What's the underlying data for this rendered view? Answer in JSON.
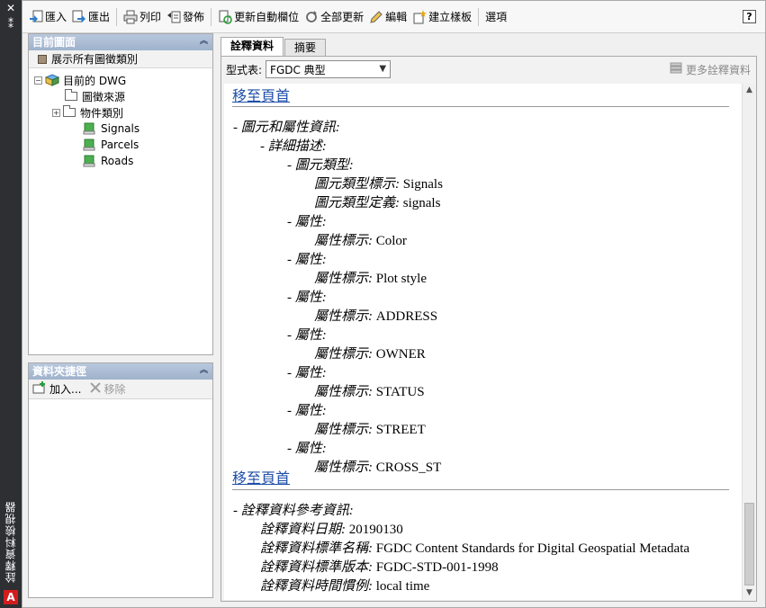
{
  "sidebar_strip": {
    "close_glyph": "✕",
    "menu_glyph": "⁑",
    "title": "詮釋資料檢視器",
    "logo_letter": "A"
  },
  "toolbar": {
    "import_label": "匯入",
    "export_label": "匯出",
    "print_label": "列印",
    "publish_label": "發佈",
    "update_auto_fields_label": "更新自動欄位",
    "update_all_label": "全部更新",
    "edit_label": "編輯",
    "create_template_label": "建立樣板",
    "options_label": "選項",
    "help_label": "?"
  },
  "current_drawing_panel": {
    "title": "目前圖面",
    "show_all_label": "展示所有圖徵類別",
    "tree": {
      "root": "目前的 DWG",
      "feature_source": "圖徵來源",
      "object_classes": "物件類別",
      "layers": [
        "Signals",
        "Parcels",
        "Roads"
      ]
    }
  },
  "folder_shortcuts_panel": {
    "title": "資料夾捷徑",
    "add_label": "加入...",
    "remove_label": "移除"
  },
  "tabs": [
    {
      "label": "詮釋資料",
      "active": true
    },
    {
      "label": "摘要",
      "active": false
    }
  ],
  "style": {
    "label": "型式表:",
    "selected": "FGDC 典型",
    "more_metadata_label": "更多詮釋資料"
  },
  "document": {
    "top_link": "移至頁首",
    "entity_section": "圖元和屬性資訊:",
    "detailed_description": "詳細描述:",
    "entity_type": "圖元類型:",
    "entity_type_label_key": "圖元類型標示:",
    "entity_type_label_value": "Signals",
    "entity_type_def_key": "圖元類型定義:",
    "entity_type_def_value": "signals",
    "attribute_key": "屬性:",
    "attribute_label_key": "屬性標示:",
    "attributes": [
      "Color",
      "Plot style",
      "ADDRESS",
      "OWNER",
      "STATUS",
      "STREET",
      "CROSS_ST"
    ],
    "bottom_link": "移至頁首",
    "meta_ref_section": "詮釋資料參考資訊:",
    "meta_date_key": "詮釋資料日期:",
    "meta_date_value": "20190130",
    "meta_std_name_key": "詮釋資料標準名稱:",
    "meta_std_name_value": "FGDC Content Standards for Digital Geospatial Metadata",
    "meta_std_version_key": "詮釋資料標準版本:",
    "meta_std_version_value": "FGDC-STD-001-1998",
    "meta_time_key": "詮釋資料時間慣例:",
    "meta_time_value": "local time"
  },
  "colors": {
    "link": "#1f4fa8",
    "panel_header": "#a9bad3",
    "strip": "#2d2f33"
  }
}
